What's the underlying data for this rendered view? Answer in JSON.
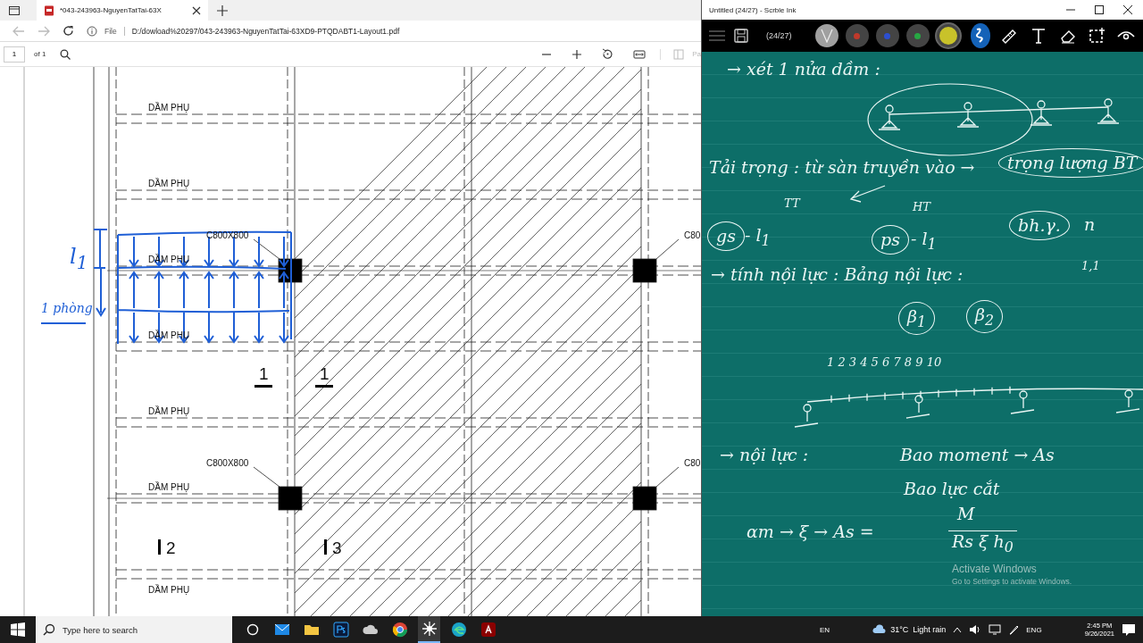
{
  "browser": {
    "tab_title": "*043-243963-NguyenTatTai-63X",
    "address_scheme": "File",
    "address": "D:/dowload%20297/043-243963-NguyenTatTai-63XD9-PTQDABT1-Layout1.pdf",
    "page_number": "1",
    "page_count": "of 1",
    "side_label": "Pa"
  },
  "plan": {
    "beam_labels": [
      "DẦM PHỤ",
      "DẦM PHỤ",
      "DẦM PHỤ",
      "DẦM PHỤ",
      "DẦM PHỤ",
      "DẦM PHỤ",
      "DẦM PHỤ"
    ],
    "column_labels": [
      "C800X800",
      "C80",
      "C800X800",
      "C80"
    ],
    "section_marks": [
      {
        "label": "1",
        "kind": "underlined"
      },
      {
        "label": "1",
        "kind": "underlined"
      },
      {
        "label": "2",
        "kind": "bar"
      },
      {
        "label": "3",
        "kind": "bar"
      }
    ],
    "ink_notes": [
      "l$_{1}$",
      "1 phòng"
    ]
  },
  "ink_window": {
    "title": "Untitled (24/27) - Scrble Ink",
    "page_counter": "(24/27)",
    "pens": [
      {
        "kind": "highlighter",
        "color": "#a0a0a0",
        "selected": false
      },
      {
        "kind": "pen",
        "color": "#c0392b",
        "selected": false
      },
      {
        "kind": "pen",
        "color": "#2c4fd0",
        "selected": false
      },
      {
        "kind": "pen",
        "color": "#27a843",
        "selected": false
      },
      {
        "kind": "pen",
        "color": "#c8c22a",
        "selected": true
      }
    ],
    "tools": [
      {
        "kind": "ink",
        "selected": true
      },
      {
        "kind": "ruler",
        "selected": false
      },
      {
        "kind": "text",
        "selected": false
      },
      {
        "kind": "eraser",
        "selected": false
      },
      {
        "kind": "select",
        "selected": false
      },
      {
        "kind": "view",
        "selected": false
      }
    ],
    "notes": [
      {
        "kind": "line",
        "text": "→ xét 1 nửa dầm :"
      },
      {
        "kind": "line",
        "text": "Tải trọng : từ sàn truyền vào →"
      },
      {
        "kind": "circled",
        "text": "trọng lượng BT"
      },
      {
        "kind": "small",
        "text": "TT"
      },
      {
        "kind": "circled",
        "text": "gs"
      },
      {
        "kind": "line",
        "text": "- l$_{1}$"
      },
      {
        "kind": "small",
        "text": "HT"
      },
      {
        "kind": "circled",
        "text": "ps"
      },
      {
        "kind": "line",
        "text": "- l$_{1}$"
      },
      {
        "kind": "circled",
        "text": "bh.γ."
      },
      {
        "kind": "line",
        "text": "n"
      },
      {
        "kind": "line",
        "text": "→ tính nội lực : Bảng nội lực :"
      },
      {
        "kind": "small",
        "text": "1,1"
      },
      {
        "kind": "circled",
        "text": "β$_{1}$"
      },
      {
        "kind": "circled",
        "text": "β$_{2}$"
      },
      {
        "kind": "small",
        "text": "1 2 3 4 5 6 7 8 9 10"
      },
      {
        "kind": "line",
        "text": "→ nội lực :"
      },
      {
        "kind": "line",
        "text": "Bao moment → As"
      },
      {
        "kind": "line",
        "text": "Bao lực cắt"
      },
      {
        "kind": "line",
        "text": "αm → ξ → As ="
      },
      {
        "kind": "line",
        "text": "M"
      },
      {
        "kind": "fraction",
        "text": "Rs ξ h$_{0}$"
      }
    ],
    "activation": {
      "title": "Activate Windows",
      "subtitle": "Go to Settings to activate Windows."
    }
  },
  "taskbar": {
    "search_placeholder": "Type here to search",
    "input_language": "EN",
    "weather": "31°C  Light rain",
    "keyboard": "ENG",
    "time": "2:45 PM",
    "date": "9/26/2021"
  }
}
